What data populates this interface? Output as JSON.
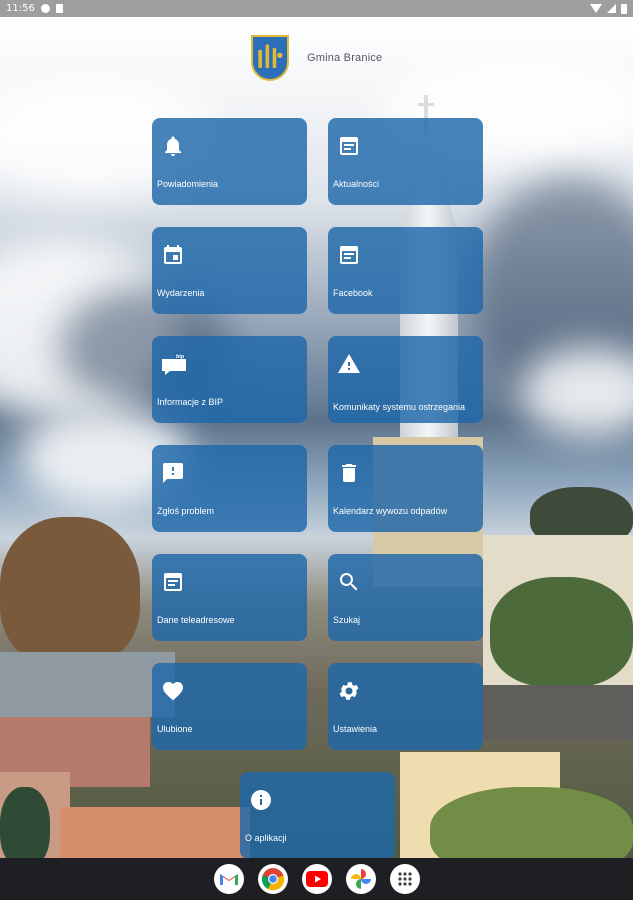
{
  "status_bar": {
    "time": "11:56"
  },
  "header": {
    "title": "Gmina Branice"
  },
  "tiles": [
    {
      "label": "Powiadomienia"
    },
    {
      "label": "Aktualności"
    },
    {
      "label": "Wydarzenia"
    },
    {
      "label": "Facebook"
    },
    {
      "label": "Informacje z BIP",
      "badge": "bip"
    },
    {
      "label": "Komunikaty systemu ostrzegania"
    },
    {
      "label": "Zgłoś problem"
    },
    {
      "label": "Kalendarz wywozu odpadów"
    },
    {
      "label": "Dane teleadresowe"
    },
    {
      "label": "Szukaj"
    },
    {
      "label": "Ulubione"
    },
    {
      "label": "Ustawienia"
    },
    {
      "label": "O aplikacji"
    }
  ],
  "dock": [
    {
      "icon": "gmail-icon"
    },
    {
      "icon": "chrome-icon"
    },
    {
      "icon": "youtube-icon"
    },
    {
      "icon": "photos-icon"
    },
    {
      "icon": "app-drawer-icon"
    }
  ],
  "colors": {
    "tile": "#1f68aa",
    "status_bar": "#9e9e9e",
    "nav_bar": "#1e1f22"
  }
}
